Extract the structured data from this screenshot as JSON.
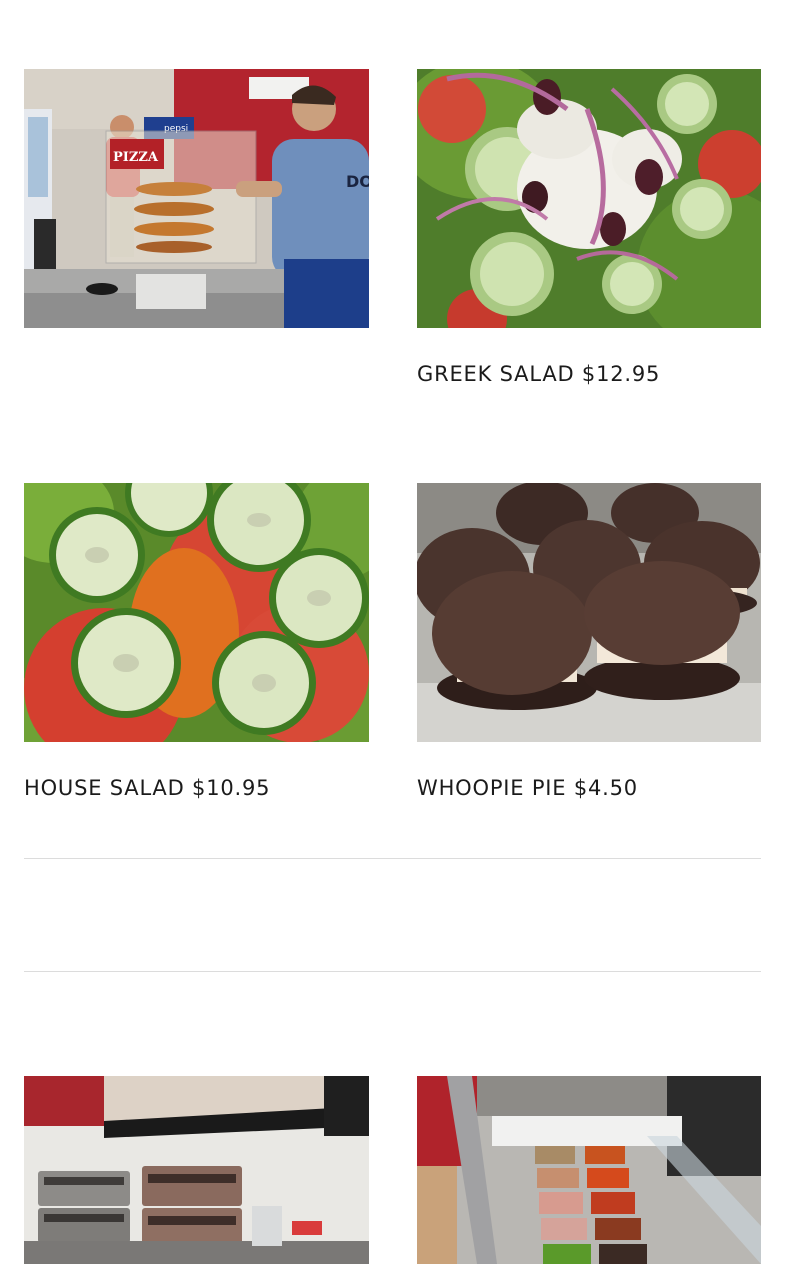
{
  "menu_items": [
    {
      "caption": ""
    },
    {
      "caption": "GREEK SALAD $12.95"
    },
    {
      "caption": "HOUSE SALAD $10.95"
    },
    {
      "caption": "WHOOPIE PIE $4.50"
    }
  ],
  "gallery": [
    {
      "caption": ""
    },
    {
      "caption": ""
    }
  ],
  "photo_text": {
    "pizza_sign": "PIZZA",
    "pepsi": "pepsi",
    "shirt": "DO"
  }
}
